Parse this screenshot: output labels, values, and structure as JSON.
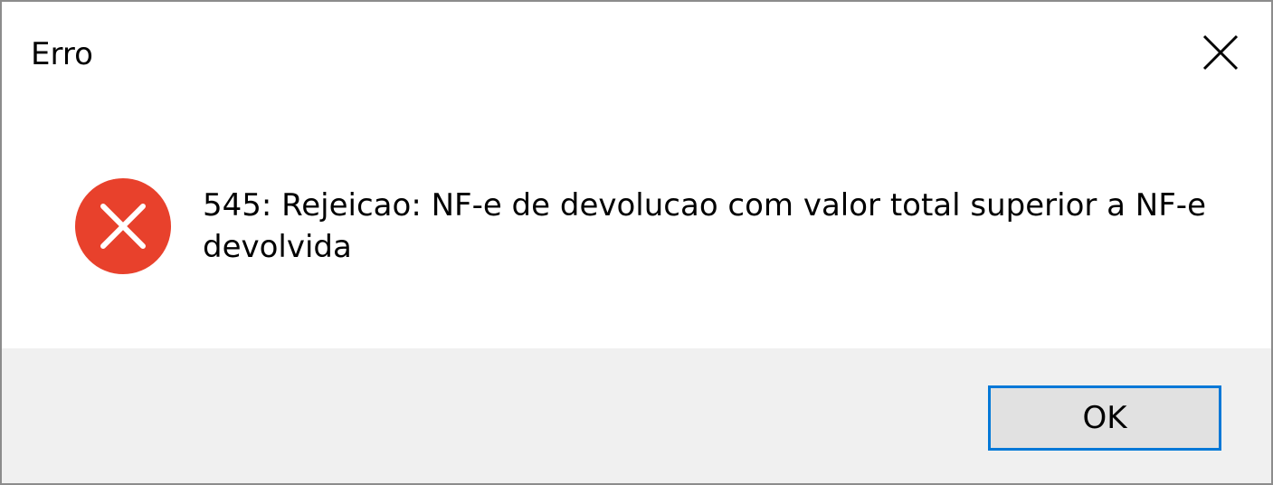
{
  "dialog": {
    "title": "Erro",
    "message": "545: Rejeicao: NF-e de devolucao com valor total superior a NF-e devolvida",
    "icon": "error-icon",
    "ok_label": "OK",
    "close_icon": "close-icon"
  },
  "colors": {
    "error_red": "#e8412c",
    "accent_blue": "#0078d7",
    "footer_bg": "#f0f0f0",
    "button_bg": "#e1e1e1"
  }
}
